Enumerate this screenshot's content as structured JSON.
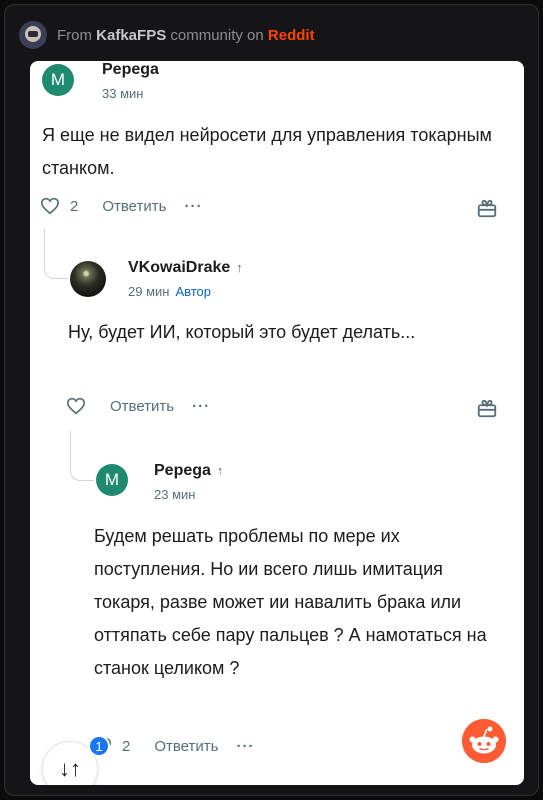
{
  "header": {
    "prefix": "From",
    "community": "KafkaFPS",
    "middle": "community on",
    "platform": "Reddit"
  },
  "comments": [
    {
      "avatar_letter": "M",
      "author": "Pepega",
      "time": "33 мин",
      "text": "Я еще не видел нейросети для управления токарным станком.",
      "votes": "2",
      "reply_label": "Ответить",
      "more": "···"
    },
    {
      "author": "VKowaiDrake",
      "upvote_mark": "↑",
      "time": "29 мин",
      "tag": "Автор",
      "text": "Ну, будет ИИ, который это будет делать...",
      "reply_label": "Ответить",
      "more": "···"
    },
    {
      "avatar_letter": "M",
      "author": "Pepega",
      "upvote_mark": "↑",
      "time": "23 мин",
      "text": "Будем решать проблемы по мере их поступления. Но ии всего лишь имитация токаря, разве может ии навалить брака или оттяпать себе пару пальцев ? А намотаться на станок целиком ?",
      "votes": "2",
      "reply_label": "Ответить",
      "more": "···"
    }
  ],
  "overlay": {
    "badge_count": "1",
    "sort_symbol": "↓↑"
  }
}
